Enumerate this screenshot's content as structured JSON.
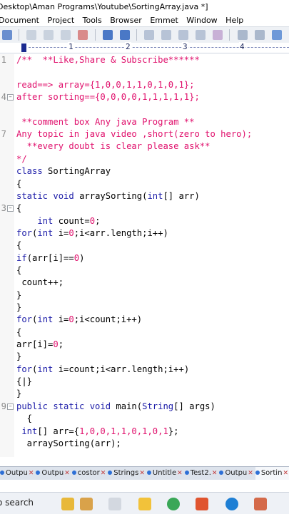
{
  "window": {
    "title": "Desktop\\Aman Programs\\Youtube\\SortingArray.java *]"
  },
  "menu": [
    "Document",
    "Project",
    "Tools",
    "Browser",
    "Emmet",
    "Window",
    "Help"
  ],
  "ruler": {
    "marks": [
      "1",
      "2",
      "3",
      "4"
    ]
  },
  "editor": {
    "lines": [
      {
        "n": "1",
        "fold": false,
        "segs": [
          {
            "c": "c",
            "t": "/**  **Like,Share & Subscribe******"
          }
        ]
      },
      {
        "n": "",
        "fold": false,
        "segs": []
      },
      {
        "n": "",
        "fold": false,
        "segs": [
          {
            "c": "c",
            "t": "read==> array={1,0,0,1,1,0,1,0,1};"
          }
        ]
      },
      {
        "n": "4",
        "fold": true,
        "segs": [
          {
            "c": "c",
            "t": "after sorting=={0,0,0,0,1,1,1,1,1};"
          }
        ]
      },
      {
        "n": "",
        "fold": false,
        "segs": []
      },
      {
        "n": "",
        "fold": false,
        "segs": [
          {
            "c": "c",
            "t": " **comment box Any java Program **"
          }
        ]
      },
      {
        "n": "7",
        "fold": false,
        "segs": [
          {
            "c": "c",
            "t": "Any topic in java video ,short(zero to hero);"
          }
        ]
      },
      {
        "n": "",
        "fold": false,
        "segs": [
          {
            "c": "c",
            "t": "  **every doubt is clear please ask**"
          }
        ]
      },
      {
        "n": "",
        "fold": false,
        "segs": [
          {
            "c": "c",
            "t": "*/"
          }
        ]
      },
      {
        "n": "",
        "fold": false,
        "segs": [
          {
            "c": "k",
            "t": "class "
          },
          {
            "c": "p",
            "t": "SortingArray"
          }
        ]
      },
      {
        "n": "",
        "fold": false,
        "segs": [
          {
            "c": "p",
            "t": "{"
          }
        ]
      },
      {
        "n": "",
        "fold": false,
        "segs": [
          {
            "c": "k",
            "t": "static void "
          },
          {
            "c": "p",
            "t": "arraySorting("
          },
          {
            "c": "k",
            "t": "int"
          },
          {
            "c": "p",
            "t": "[] arr)"
          }
        ]
      },
      {
        "n": "3",
        "fold": true,
        "segs": [
          {
            "c": "p",
            "t": "{"
          }
        ]
      },
      {
        "n": "",
        "fold": false,
        "segs": [
          {
            "c": "k",
            "t": "    int "
          },
          {
            "c": "p",
            "t": "count="
          },
          {
            "c": "n",
            "t": "0"
          },
          {
            "c": "p",
            "t": ";"
          }
        ]
      },
      {
        "n": "",
        "fold": false,
        "segs": [
          {
            "c": "k",
            "t": "for"
          },
          {
            "c": "p",
            "t": "("
          },
          {
            "c": "k",
            "t": "int "
          },
          {
            "c": "p",
            "t": "i="
          },
          {
            "c": "n",
            "t": "0"
          },
          {
            "c": "p",
            "t": ";i<arr.length;i++)"
          }
        ]
      },
      {
        "n": "",
        "fold": false,
        "segs": [
          {
            "c": "p",
            "t": "{"
          }
        ]
      },
      {
        "n": "",
        "fold": false,
        "segs": [
          {
            "c": "k",
            "t": "if"
          },
          {
            "c": "p",
            "t": "(arr[i]=="
          },
          {
            "c": "n",
            "t": "0"
          },
          {
            "c": "p",
            "t": ")"
          }
        ]
      },
      {
        "n": "",
        "fold": false,
        "segs": [
          {
            "c": "p",
            "t": "{"
          }
        ]
      },
      {
        "n": "",
        "fold": false,
        "segs": [
          {
            "c": "p",
            "t": " count++;"
          }
        ]
      },
      {
        "n": "",
        "fold": false,
        "segs": [
          {
            "c": "p",
            "t": "}"
          }
        ]
      },
      {
        "n": "",
        "fold": false,
        "segs": [
          {
            "c": "p",
            "t": "}"
          }
        ]
      },
      {
        "n": "",
        "fold": false,
        "segs": [
          {
            "c": "k",
            "t": "for"
          },
          {
            "c": "p",
            "t": "("
          },
          {
            "c": "k",
            "t": "int "
          },
          {
            "c": "p",
            "t": "i="
          },
          {
            "c": "n",
            "t": "0"
          },
          {
            "c": "p",
            "t": ";i<count;i++)"
          }
        ]
      },
      {
        "n": "",
        "fold": false,
        "segs": [
          {
            "c": "p",
            "t": "{"
          }
        ]
      },
      {
        "n": "",
        "fold": false,
        "segs": [
          {
            "c": "p",
            "t": "arr[i]="
          },
          {
            "c": "n",
            "t": "0"
          },
          {
            "c": "p",
            "t": ";"
          }
        ]
      },
      {
        "n": "",
        "fold": false,
        "segs": [
          {
            "c": "p",
            "t": "}"
          }
        ]
      },
      {
        "n": "",
        "fold": false,
        "segs": [
          {
            "c": "k",
            "t": "for"
          },
          {
            "c": "p",
            "t": "("
          },
          {
            "c": "k",
            "t": "int "
          },
          {
            "c": "p",
            "t": "i=count;i<arr.length;i++)"
          }
        ]
      },
      {
        "n": "",
        "fold": false,
        "segs": [
          {
            "c": "p",
            "t": "{|}"
          }
        ]
      },
      {
        "n": "",
        "fold": false,
        "segs": [
          {
            "c": "p",
            "t": "}"
          }
        ]
      },
      {
        "n": "9",
        "fold": true,
        "segs": [
          {
            "c": "k",
            "t": "public static void "
          },
          {
            "c": "p",
            "t": "main("
          },
          {
            "c": "k",
            "t": "String"
          },
          {
            "c": "p",
            "t": "[] args)"
          }
        ]
      },
      {
        "n": "",
        "fold": false,
        "segs": [
          {
            "c": "p",
            "t": "  {"
          }
        ]
      },
      {
        "n": "",
        "fold": false,
        "segs": [
          {
            "c": "k",
            "t": " int"
          },
          {
            "c": "p",
            "t": "[] arr={"
          },
          {
            "c": "n",
            "t": "1,0,0,1,1,0,1,0,1"
          },
          {
            "c": "p",
            "t": "};"
          }
        ]
      },
      {
        "n": "",
        "fold": false,
        "segs": [
          {
            "c": "p",
            "t": "  arraySorting(arr);"
          }
        ]
      }
    ]
  },
  "tabs": [
    {
      "label": "Outpu",
      "active": false
    },
    {
      "label": "Outpu",
      "active": false
    },
    {
      "label": "costor",
      "active": false
    },
    {
      "label": "Strings",
      "active": false
    },
    {
      "label": "Untitle",
      "active": false
    },
    {
      "label": "Test2.",
      "active": false
    },
    {
      "label": "Outpu",
      "active": false
    },
    {
      "label": "Sortin",
      "active": true
    }
  ],
  "taskbar": {
    "search_text": "o search"
  },
  "colors": {
    "comment": "#e0106c",
    "keyword": "#1c1ca8",
    "number": "#e0106c"
  }
}
